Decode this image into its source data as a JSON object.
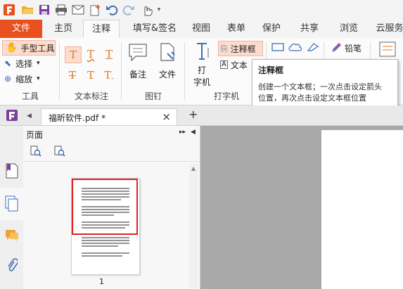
{
  "app": {
    "brand_color": "#e8511f",
    "accent_highlight": "#fcdccd"
  },
  "quick_access": {
    "icons": [
      "app-logo-icon",
      "open-folder-icon",
      "save-icon",
      "print-icon",
      "email-icon",
      "new-icon",
      "undo-icon",
      "redo-icon",
      "hand-pointer-icon",
      "dropdown-icon"
    ]
  },
  "tabs": [
    {
      "label": "文件"
    },
    {
      "label": "主页"
    },
    {
      "label": "注释"
    },
    {
      "label": "填写&签名"
    },
    {
      "label": "视图"
    },
    {
      "label": "表单"
    },
    {
      "label": "保护"
    },
    {
      "label": "共享"
    },
    {
      "label": "浏览"
    },
    {
      "label": "云服务"
    }
  ],
  "active_tab": "注释",
  "ribbon": {
    "tools": {
      "hand": "手型工具",
      "select": "选择",
      "zoom": "缩放",
      "group": "工具"
    },
    "text_markup": {
      "group": "文本标注"
    },
    "pin": {
      "note": "备注",
      "file": "文件",
      "group": "图钉"
    },
    "typewriter": {
      "typewriter_line1": "打",
      "typewriter_line2": "字机",
      "callout": "注释框",
      "textbox": "文本",
      "group": "打字机"
    },
    "pencil": "铅笔"
  },
  "tooltip": {
    "title": "注释框",
    "line1": "创建一个文本框；一次点击设定箭头",
    "line2": "位置，再次点击设定文本框位置"
  },
  "document_tab": {
    "title": "福昕软件.pdf *",
    "close": "×",
    "add": "+"
  },
  "pages_panel": {
    "title": "页面",
    "page_number": "1"
  }
}
